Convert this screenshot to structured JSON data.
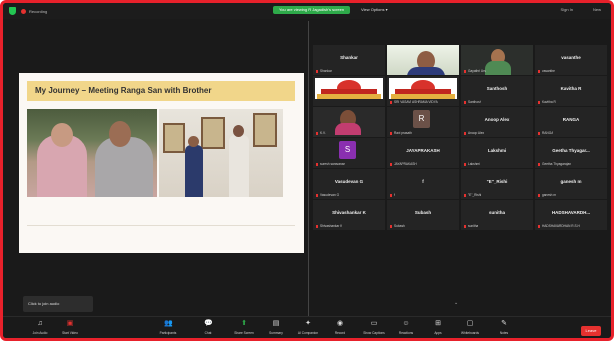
{
  "topbar": {
    "recording": "Recording",
    "share_notice": "You are viewing R Jagadish's screen",
    "view_options": "View Options ▾",
    "sign_in": "Sign In",
    "new": "New"
  },
  "slide": {
    "title": "My Journey – Meeting Ranga San with Brother"
  },
  "participants": [
    {
      "display": "Shankar",
      "label": "Shankar",
      "kind": "name"
    },
    {
      "display": "",
      "label": "",
      "kind": "host-video"
    },
    {
      "display": "",
      "label": "Gayathri Urs",
      "kind": "video-2"
    },
    {
      "display": "vasanthe",
      "label": "vasanthe",
      "kind": "name"
    },
    {
      "display": "",
      "label": "",
      "kind": "poster"
    },
    {
      "display": "",
      "label": "SRI VASAVI ASHRAMA VIDYA",
      "kind": "poster"
    },
    {
      "display": "Santhosh",
      "label": "Santhosh",
      "kind": "name"
    },
    {
      "display": "Kavitha R",
      "label": "Kavitha R",
      "kind": "name"
    },
    {
      "display": "",
      "label": "K.V.",
      "kind": "video-kv"
    },
    {
      "display": "R",
      "label": "Ravi prasath",
      "kind": "avatar",
      "color": "#6b5148"
    },
    {
      "display": "Anoop Alex",
      "label": "Anoop Alex",
      "kind": "name"
    },
    {
      "display": "RANGA",
      "label": "RANGA",
      "kind": "name"
    },
    {
      "display": "S",
      "label": "suresh saravanan",
      "kind": "avatar",
      "color": "#8a2fb0"
    },
    {
      "display": "JAYAPRAKASH",
      "label": "JAYAPRAKASH",
      "kind": "name"
    },
    {
      "display": "Lakshmi",
      "label": "Lakshmi",
      "kind": "name"
    },
    {
      "display": "Geetha Thyagar...",
      "label": "Geetha Thyagarajan",
      "kind": "name"
    },
    {
      "display": "Vasudevan G",
      "label": "Vasudevan G",
      "kind": "name"
    },
    {
      "display": "f",
      "label": "f",
      "kind": "name"
    },
    {
      "display": "\"E\"_Rishi",
      "label": "\"E\"_Rishi",
      "kind": "name"
    },
    {
      "display": "ganesh m",
      "label": "ganesh m",
      "kind": "name"
    },
    {
      "display": "Shivashankar K",
      "label": "Shivashankar K",
      "kind": "name"
    },
    {
      "display": "Subash",
      "label": "Subash",
      "kind": "name"
    },
    {
      "display": "sunitha",
      "label": "sunitha",
      "kind": "name"
    },
    {
      "display": "HADSHAVARDH...",
      "label": "HADSHAVARDHAN R.S.H",
      "kind": "name"
    }
  ],
  "self_box": "Click to join audio",
  "toolbar": {
    "items": [
      {
        "label": "Join Audio",
        "icon": "headphones-icon",
        "glyph": "♫",
        "muted": false
      },
      {
        "label": "Start Video",
        "icon": "video-off-icon",
        "glyph": "▣",
        "muted": true
      },
      {
        "label": "Participants",
        "icon": "participants-icon",
        "glyph": "👥",
        "muted": false
      },
      {
        "label": "Chat",
        "icon": "chat-icon",
        "glyph": "💬",
        "muted": false
      },
      {
        "label": "Share Screen",
        "icon": "share-screen-icon",
        "glyph": "⬆",
        "muted": false
      },
      {
        "label": "Summary",
        "icon": "summary-icon",
        "glyph": "▤",
        "muted": false
      },
      {
        "label": "AI Companion",
        "icon": "ai-companion-icon",
        "glyph": "✦",
        "muted": false
      },
      {
        "label": "Record",
        "icon": "record-icon",
        "glyph": "◉",
        "muted": false
      },
      {
        "label": "Show Captions",
        "icon": "captions-icon",
        "glyph": "▭",
        "muted": false
      },
      {
        "label": "Reactions",
        "icon": "reactions-icon",
        "glyph": "☺",
        "muted": false
      },
      {
        "label": "Apps",
        "icon": "apps-icon",
        "glyph": "⊞",
        "muted": false
      },
      {
        "label": "Whiteboards",
        "icon": "whiteboard-icon",
        "glyph": "▢",
        "muted": false
      },
      {
        "label": "Notes",
        "icon": "notes-icon",
        "glyph": "✎",
        "muted": false
      }
    ],
    "leave": "Leave"
  },
  "colors": {
    "border": "#e8212b",
    "share_green": "#2eaa4a",
    "muted_red": "#e5312f"
  }
}
